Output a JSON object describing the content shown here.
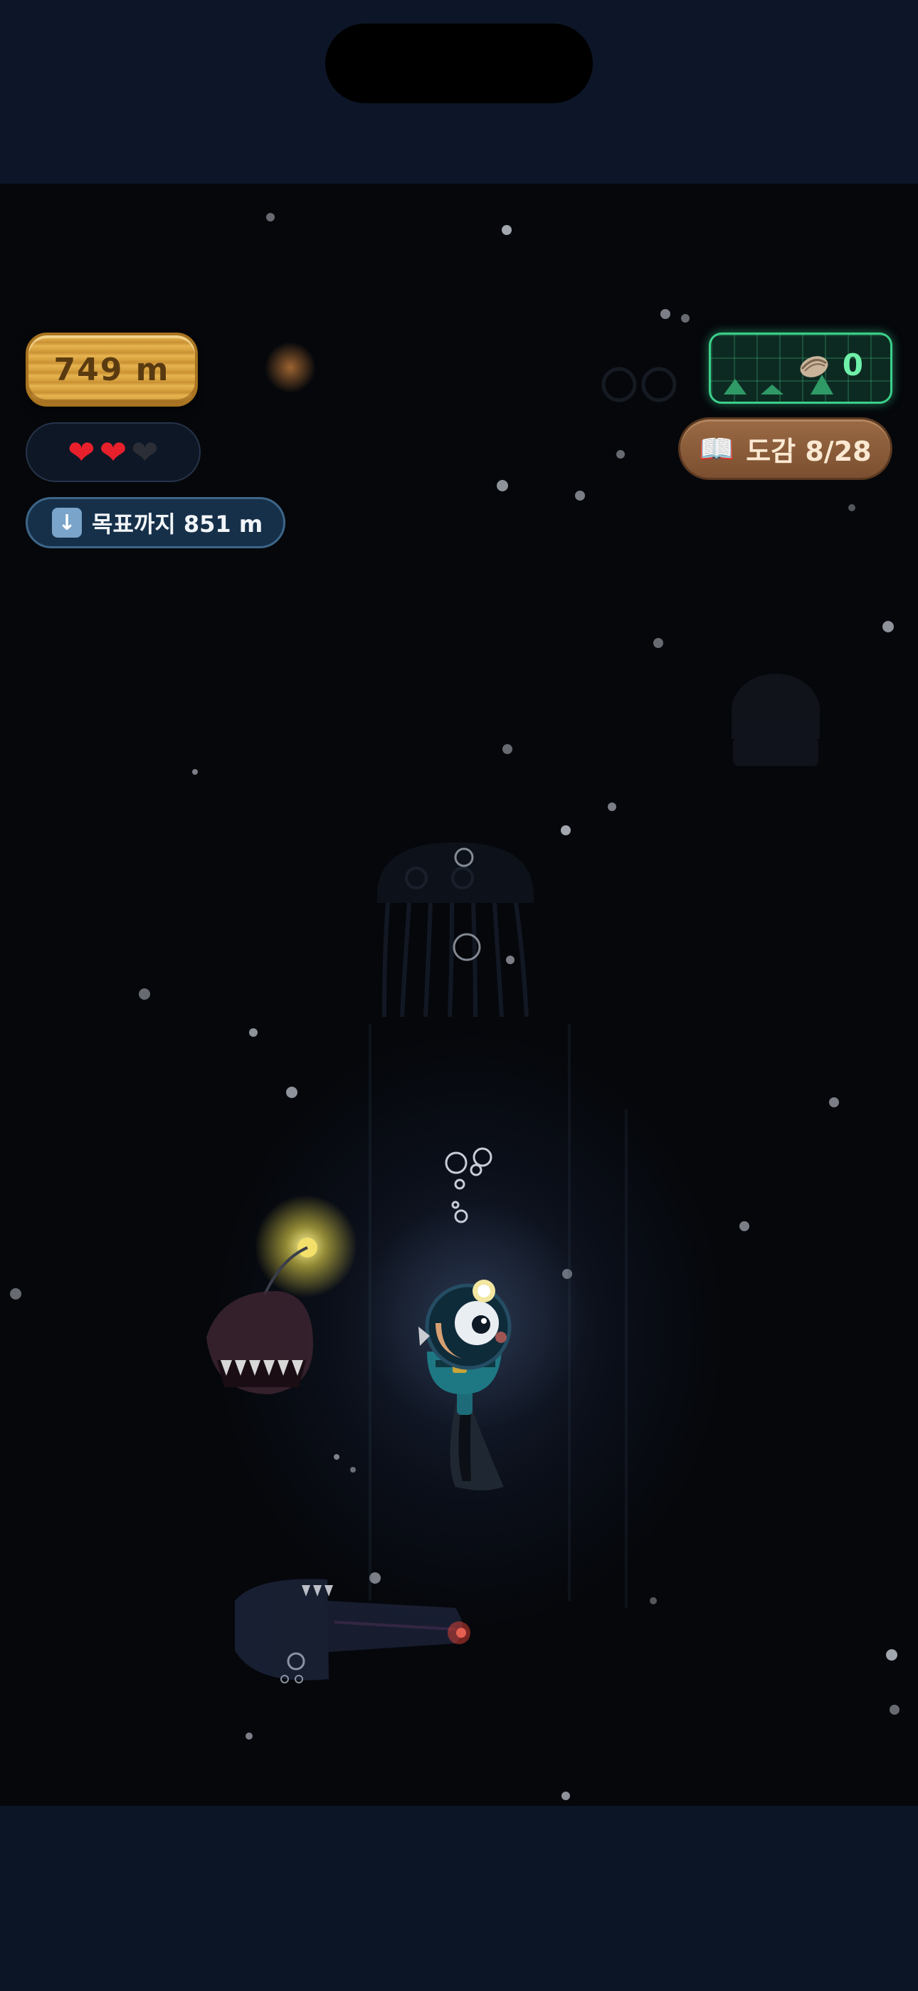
{
  "hud": {
    "depth_label": "749 m",
    "hearts": {
      "total": 3,
      "filled": 2
    },
    "goal_label": "목표까지 851 m",
    "sonar_count": "0",
    "codex_label": "도감 8/28"
  },
  "icons": {
    "goal": "down-arrow-icon",
    "sonar": "oyster-icon",
    "codex": "open-book-icon"
  },
  "colors": {
    "depth_gold": "#d9a440",
    "heart_red": "#e8202c",
    "sonar_green": "#3ad08a",
    "codex_brown": "#7b4f30",
    "water": "#05070b"
  }
}
